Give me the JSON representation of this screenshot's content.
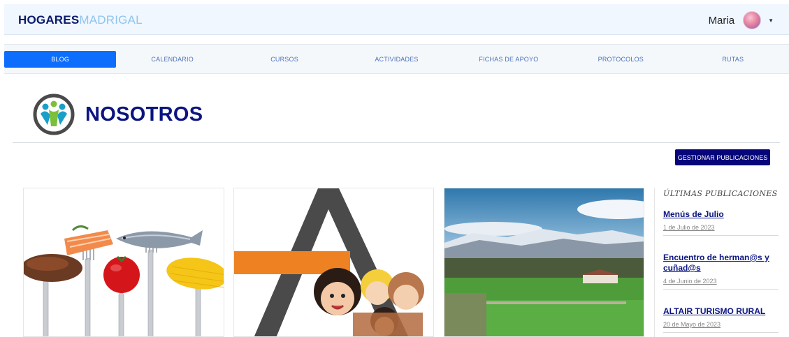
{
  "header": {
    "brand_bold": "HOGARES",
    "brand_light": "MADRIGAL",
    "user_name": "Maria"
  },
  "nav": {
    "items": [
      "BLOG",
      "CALENDARIO",
      "CURSOS",
      "ACTIVIDADES",
      "FICHAS DE APOYO",
      "PROTOCOLOS",
      "RUTAS"
    ],
    "active": "BLOG"
  },
  "page": {
    "title": "NOSOTROS",
    "manage_label": "GESTIONAR PUBLICACIONES"
  },
  "sidebar": {
    "title": "ÚLTIMAS PUBLICACIONES",
    "posts": [
      {
        "title": "Menús de Julio",
        "date": "1 de Julio de 2023"
      },
      {
        "title": "Encuentro de herman@s y cuñad@s",
        "date": "4 de Junio de 2023"
      },
      {
        "title": "ALTAIR TURISMO RURAL",
        "date": "20 de Mayo de 2023"
      }
    ]
  },
  "colors": {
    "brand_dark": "#0a1a6b",
    "brand_light": "#8ec4ee",
    "accent": "#0d6efd",
    "title": "#0b1580",
    "manage_button": "#06067a"
  }
}
